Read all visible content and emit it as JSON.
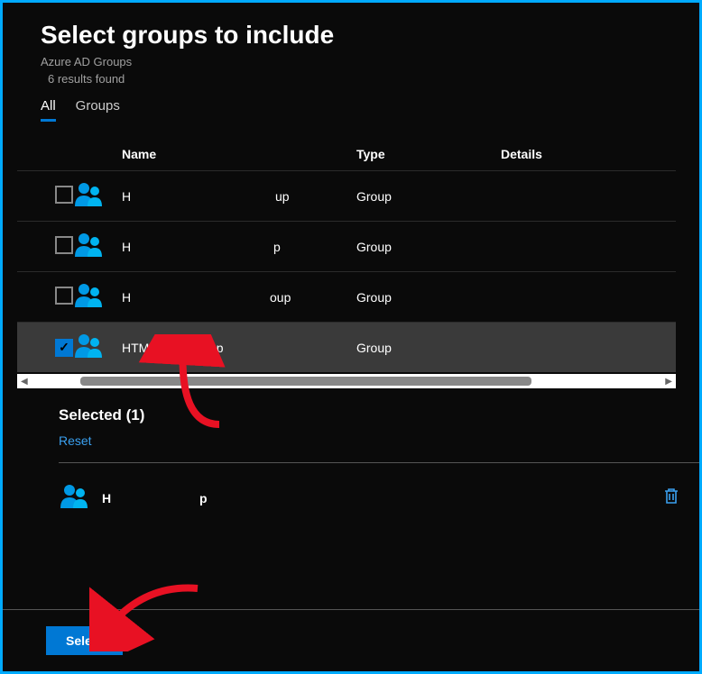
{
  "header": {
    "title": "Select groups to include",
    "subtitle": "Azure AD Groups",
    "results": "6 results found"
  },
  "tabs": {
    "all": "All",
    "groups": "Groups"
  },
  "columns": {
    "name": "Name",
    "type": "Type",
    "details": "Details"
  },
  "rows": [
    {
      "name_left": "H",
      "name_right": "up",
      "type": "Group",
      "checked": false
    },
    {
      "name_left": "H",
      "name_right": "p",
      "type": "Group",
      "checked": false
    },
    {
      "name_left": "H",
      "name_right": "oup",
      "type": "Group",
      "checked": false
    },
    {
      "name_full": "HTMD Test Group",
      "type": "Group",
      "checked": true
    }
  ],
  "selected": {
    "title": "Selected (1)",
    "reset": "Reset",
    "item_left": "H",
    "item_right": "p"
  },
  "footer": {
    "select": "Select"
  }
}
